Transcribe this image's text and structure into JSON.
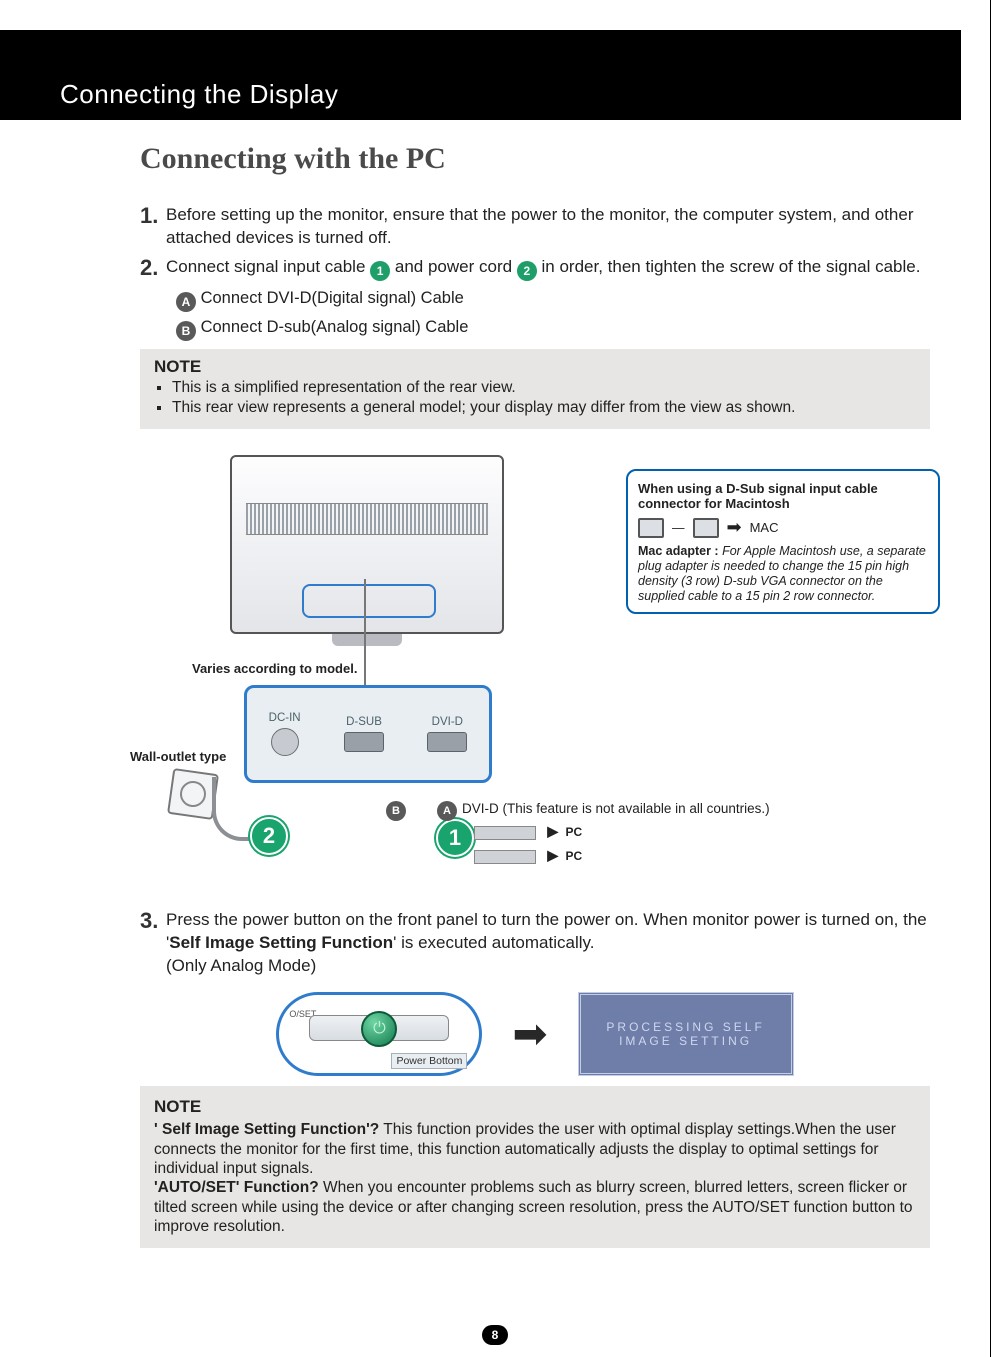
{
  "header": {
    "title": "Connecting the Display"
  },
  "section_title": "Connecting with the PC",
  "steps": {
    "s1": {
      "num": "1.",
      "text": "Before setting up the monitor, ensure that the power to the monitor, the computer system, and other attached devices is turned off."
    },
    "s2": {
      "num": "2.",
      "text_a": "Connect signal input cable ",
      "text_b": " and power cord ",
      "text_c": " in order, then tighten the screw of the signal cable.",
      "badge1": "1",
      "badge2": "2",
      "sub": {
        "a": {
          "badge": "A",
          "text": "Connect DVI-D(Digital signal) Cable"
        },
        "b": {
          "badge": "B",
          "text": "Connect D-sub(Analog signal) Cable"
        }
      }
    },
    "s3": {
      "num": "3.",
      "text_a": "Press the power button on the front panel to turn the power on. When monitor power is turned on, the '",
      "bold": "Self Image Setting Function",
      "text_b": "' is executed automatically.",
      "text_c": "(Only Analog Mode)"
    }
  },
  "note1": {
    "title": "NOTE",
    "items": [
      "This is a simplified representation of the rear view.",
      "This rear view represents a general model; your display may differ from the view as shown."
    ]
  },
  "diagram": {
    "varies": "Varies according to model.",
    "wall": "Wall-outlet type",
    "ports": {
      "dc": "DC-IN",
      "dsub": "D-SUB",
      "dvid": "DVI-D"
    },
    "dvi_note": "DVI-D (This feature is not available in all countries.)",
    "pc": "PC",
    "mac": {
      "title": "When using a D-Sub signal input cable connector for Macintosh",
      "mac_label": "MAC",
      "desc_bold": "Mac adapter : ",
      "desc": "For Apple Macintosh use, a separate plug adapter is needed to change the 15 pin high density (3 row) D-sub VGA connector on the supplied cable to a 15 pin  2 row connector."
    },
    "badge_big1": "1",
    "badge_big2": "2",
    "badgeA": "A",
    "badgeB": "B"
  },
  "step3_vis": {
    "autoset": "O/SET",
    "power_label": "Power Bottom",
    "osd_line1": "PROCESSING SELF",
    "osd_line2": "IMAGE SETTING"
  },
  "note2": {
    "title": "NOTE",
    "q1_b": "' Self Image Setting Function'?",
    "q1": " This function provides the user with optimal display settings.When the user connects the monitor for the first time, this function automatically adjusts the display to optimal settings for individual input signals.",
    "q2_b": "'AUTO/SET' Function?",
    "q2": " When you encounter problems such as blurry screen, blurred letters, screen flicker or tilted screen while using the device or after changing screen resolution, press the AUTO/SET function button to improve resolution."
  },
  "page_number": "8"
}
